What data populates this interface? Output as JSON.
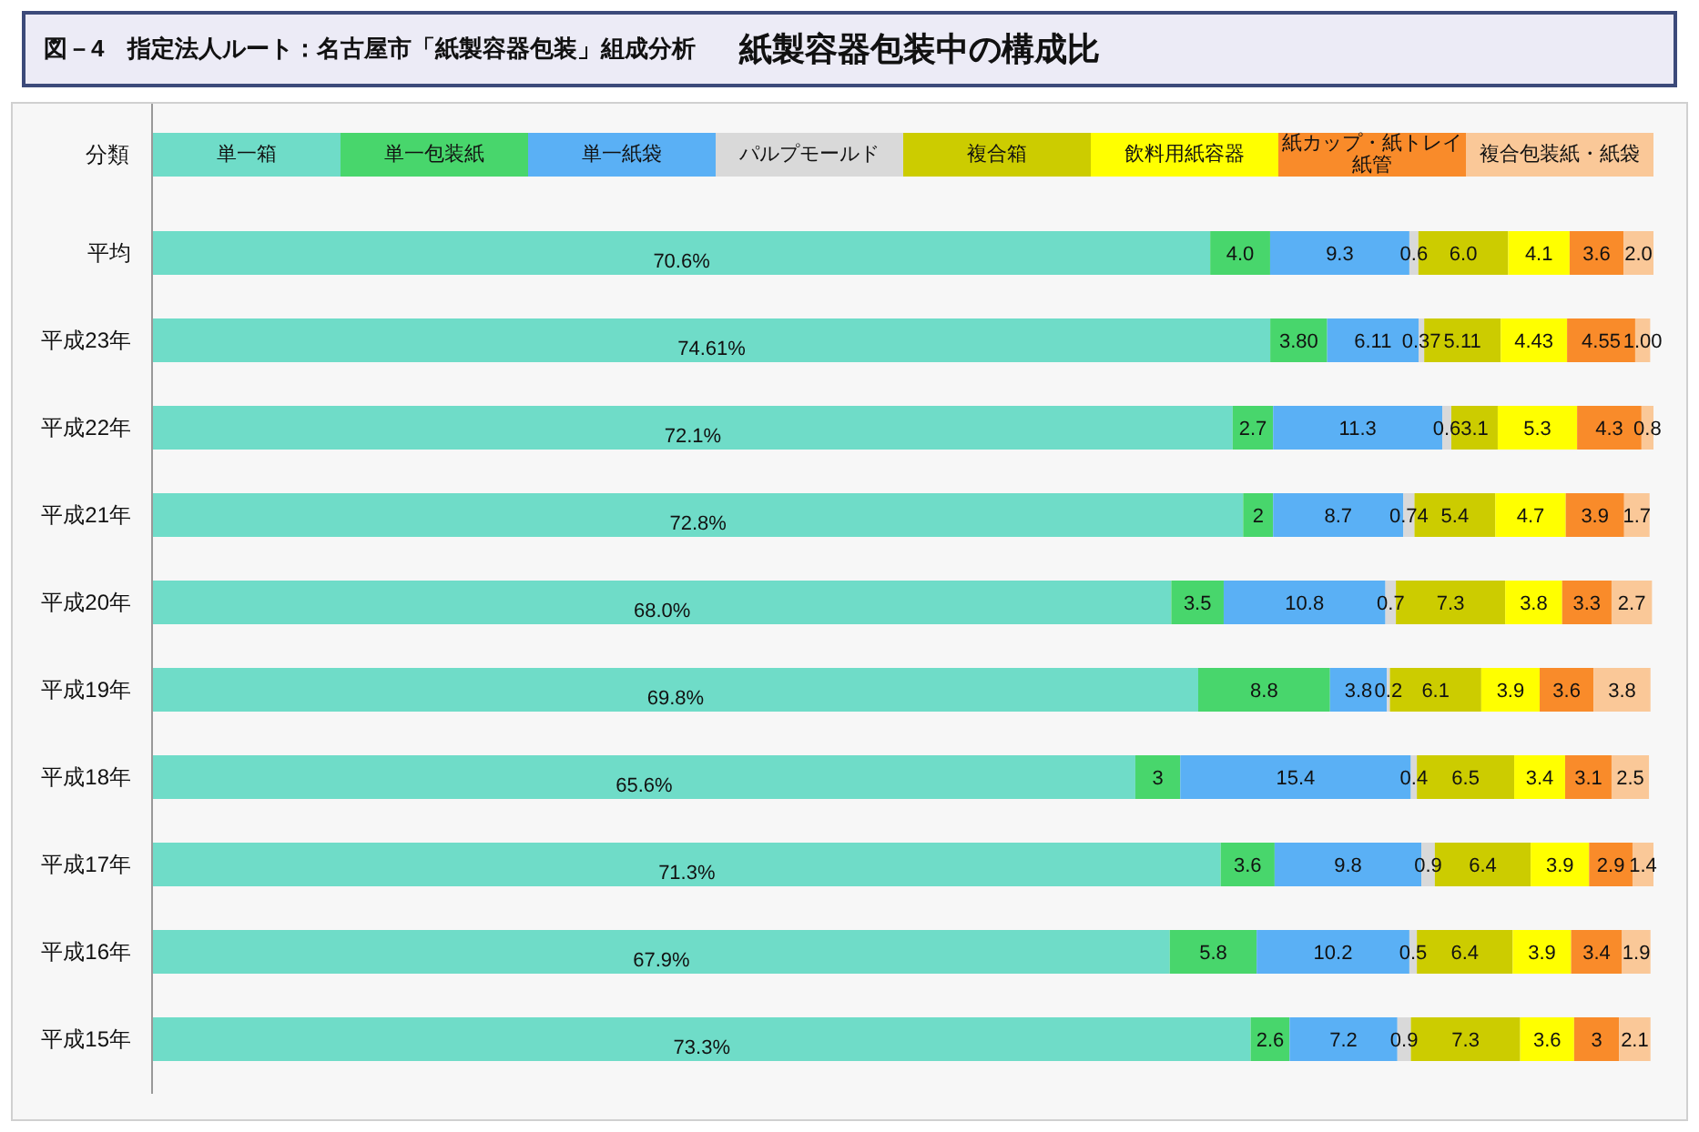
{
  "figure": {
    "label": "図－4",
    "title": "指定法人ルート：名古屋市「紙製容器包装」組成分析",
    "heading": "紙製容器包装中の構成比"
  },
  "chart": {
    "legend_title": "分類",
    "chart_data": {
      "type": "bar",
      "orientation": "horizontal",
      "stacked": true,
      "categories": [
        "平均",
        "平成23年",
        "平成22年",
        "平成21年",
        "平成20年",
        "平成19年",
        "平成18年",
        "平成17年",
        "平成16年",
        "平成15年"
      ],
      "series": [
        {
          "name": "単一箱",
          "color": "#6fdcc8",
          "values": [
            70.6,
            74.61,
            72.1,
            72.8,
            68.0,
            69.8,
            65.6,
            71.3,
            67.9,
            73.3
          ],
          "value_labels": [
            "70.6%",
            "74.61%",
            "72.1%",
            "72.8%",
            "68.0%",
            "69.8%",
            "65.6%",
            "71.3%",
            "67.9%",
            "73.3%"
          ]
        },
        {
          "name": "単一包装紙",
          "color": "#48d66c",
          "values": [
            4.0,
            3.8,
            2.7,
            2,
            3.5,
            8.8,
            3,
            3.6,
            5.8,
            2.6
          ],
          "value_labels": [
            "4.0",
            "3.80",
            "2.7",
            "2",
            "3.5",
            "8.8",
            "3",
            "3.6",
            "5.8",
            "2.6"
          ]
        },
        {
          "name": "単一紙袋",
          "color": "#5ab0f5",
          "values": [
            9.3,
            6.11,
            11.3,
            8.7,
            10.8,
            3.8,
            15.4,
            9.8,
            10.2,
            7.2
          ],
          "value_labels": [
            "9.3",
            "6.11",
            "11.3",
            "8.7",
            "10.8",
            "3.8",
            "15.4",
            "9.8",
            "10.2",
            "7.2"
          ]
        },
        {
          "name": "パルプモールド",
          "color": "#d9d9d9",
          "values": [
            0.6,
            0.37,
            0.6,
            0.74,
            0.7,
            0.2,
            0.4,
            0.9,
            0.5,
            0.9
          ],
          "value_labels": [
            "0.6",
            "0.37",
            "0.6",
            "0.74",
            "0.7",
            "0.2",
            "0.4",
            "0.9",
            "0.5",
            "0.9"
          ]
        },
        {
          "name": "複合箱",
          "color": "#cccc00",
          "values": [
            6.0,
            5.11,
            3.1,
            5.4,
            7.3,
            6.1,
            6.5,
            6.4,
            6.4,
            7.3
          ],
          "value_labels": [
            "6.0",
            "5.11",
            "3.1",
            "5.4",
            "7.3",
            "6.1",
            "6.5",
            "6.4",
            "6.4",
            "7.3"
          ]
        },
        {
          "name": "飲料用紙容器",
          "color": "#ffff00",
          "values": [
            4.1,
            4.43,
            5.3,
            4.7,
            3.8,
            3.9,
            3.4,
            3.9,
            3.9,
            3.6
          ],
          "value_labels": [
            "4.1",
            "4.43",
            "5.3",
            "4.7",
            "3.8",
            "3.9",
            "3.4",
            "3.9",
            "3.9",
            "3.6"
          ]
        },
        {
          "name": "紙カップ・紙トレイ紙管",
          "color": "#f98b2a",
          "values": [
            3.6,
            4.55,
            4.3,
            3.9,
            3.3,
            3.6,
            3.1,
            2.9,
            3.4,
            3
          ],
          "value_labels": [
            "3.6",
            "4.55",
            "4.3",
            "3.9",
            "3.3",
            "3.6",
            "3.1",
            "2.9",
            "3.4",
            "3"
          ]
        },
        {
          "name": "複合包装紙・紙袋",
          "color": "#fac898",
          "values": [
            2.0,
            1.0,
            0.8,
            1.7,
            2.7,
            3.8,
            2.5,
            1.4,
            1.9,
            2.1
          ],
          "value_labels": [
            "2.0",
            "1.00",
            "0.8",
            "1.7",
            "2.7",
            "3.8",
            "2.5",
            "1.4",
            "1.9",
            "2.1"
          ]
        }
      ]
    }
  }
}
